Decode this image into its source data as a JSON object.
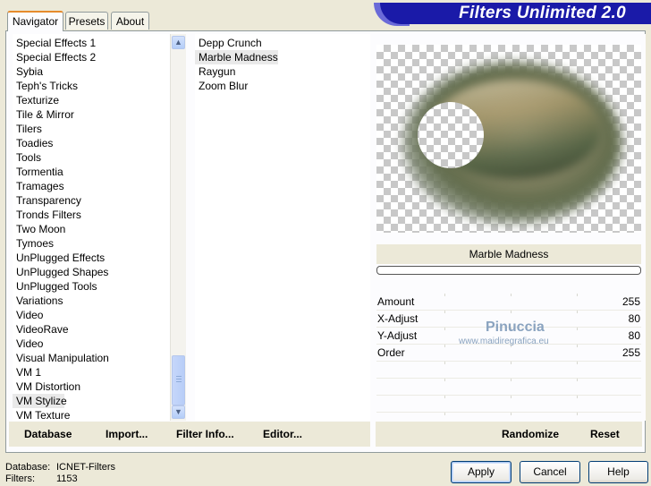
{
  "app": {
    "title": "Filters Unlimited 2.0"
  },
  "tabs": [
    {
      "label": "Navigator",
      "active": true
    },
    {
      "label": "Presets",
      "active": false
    },
    {
      "label": "About",
      "active": false
    }
  ],
  "categories": {
    "items": [
      "Special Effects 1",
      "Special Effects 2",
      "Sybia",
      "Teph's Tricks",
      "Texturize",
      "Tile & Mirror",
      "Tilers",
      "Toadies",
      "Tools",
      "Tormentia",
      "Tramages",
      "Transparency",
      "Tronds Filters",
      "Two Moon",
      "Tymoes",
      "UnPlugged Effects",
      "UnPlugged Shapes",
      "UnPlugged Tools",
      "Variations",
      "Video",
      "VideoRave",
      "Video",
      "Visual Manipulation",
      "VM 1",
      "VM Distortion",
      "VM Stylize",
      "VM Texture"
    ],
    "selected": "VM Stylize"
  },
  "filters": {
    "items": [
      "Depp Crunch",
      "Marble Madness",
      "Raygun",
      "Zoom Blur"
    ],
    "selected": "Marble Madness"
  },
  "preview": {
    "filter_name": "Marble Madness",
    "progress": 0
  },
  "params": [
    {
      "label": "Amount",
      "value": "255"
    },
    {
      "label": "X-Adjust",
      "value": "80"
    },
    {
      "label": "Y-Adjust",
      "value": "80"
    },
    {
      "label": "Order",
      "value": "255"
    }
  ],
  "watermark": {
    "name": "Pinuccia",
    "url": "www.maidiregrafica.eu"
  },
  "toolbar": {
    "database": "Database",
    "import": "Import...",
    "filter_info": "Filter Info...",
    "editor": "Editor...",
    "randomize": "Randomize",
    "reset": "Reset"
  },
  "status": {
    "database_label": "Database:",
    "database_value": "ICNET-Filters",
    "filters_label": "Filters:",
    "filters_value": "1153"
  },
  "buttons": {
    "apply": "Apply",
    "cancel": "Cancel",
    "help": "Help"
  },
  "colors": {
    "banner": "#1a1aa8",
    "tab_accent": "#e68b2c",
    "panel": "#ece9d8"
  }
}
